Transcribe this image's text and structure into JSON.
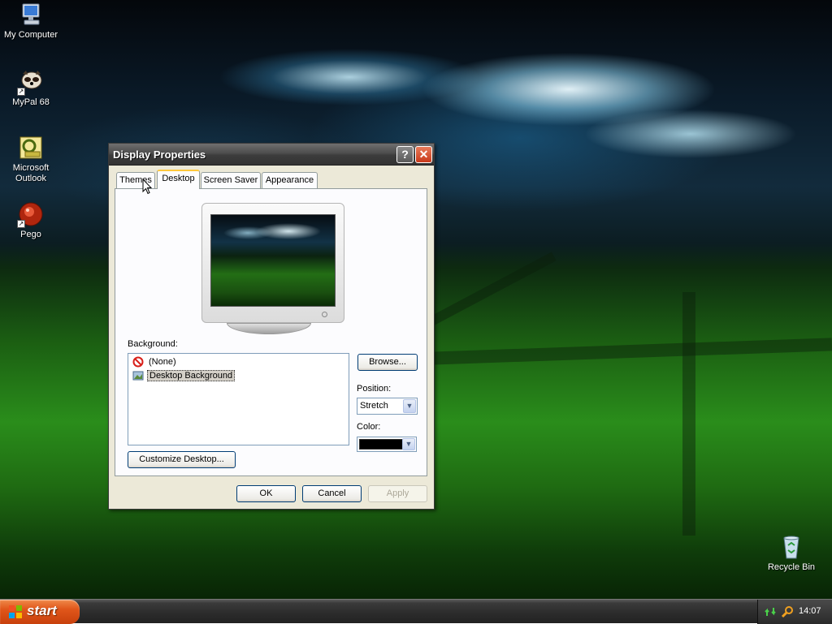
{
  "desktop": {
    "icons": [
      {
        "label": "My Computer",
        "icon": "my-computer-icon"
      },
      {
        "label": "MyPal 68",
        "icon": "mypal-browser-icon"
      },
      {
        "label": "Microsoft Outlook",
        "icon": "outlook-icon"
      },
      {
        "label": "Pego",
        "icon": "pego-icon"
      },
      {
        "label": "Recycle Bin",
        "icon": "recycle-bin-icon"
      }
    ]
  },
  "window": {
    "title": "Display Properties",
    "help_label": "?",
    "close_label": "✕",
    "tabs": [
      {
        "label": "Themes",
        "active": false
      },
      {
        "label": "Desktop",
        "active": true
      },
      {
        "label": "Screen Saver",
        "active": false
      },
      {
        "label": "Appearance",
        "active": false
      }
    ],
    "background_label": "Background:",
    "background_items": [
      {
        "label": "(None)",
        "icon": "none-icon",
        "selected": false
      },
      {
        "label": "Desktop Background",
        "icon": "image-file-icon",
        "selected": true
      }
    ],
    "browse_label": "Browse...",
    "position_label": "Position:",
    "position_value": "Stretch",
    "color_label": "Color:",
    "color_value": "#000000",
    "customize_label": "Customize Desktop...",
    "ok_label": "OK",
    "cancel_label": "Cancel",
    "apply_label": "Apply"
  },
  "taskbar": {
    "start_label": "start",
    "clock": "14:07"
  },
  "colors": {
    "start_orange": "#e0561a",
    "title_gray": "#4d4d4d",
    "dialog_face": "#ece9d8",
    "tab_highlight": "#ffc83c"
  }
}
